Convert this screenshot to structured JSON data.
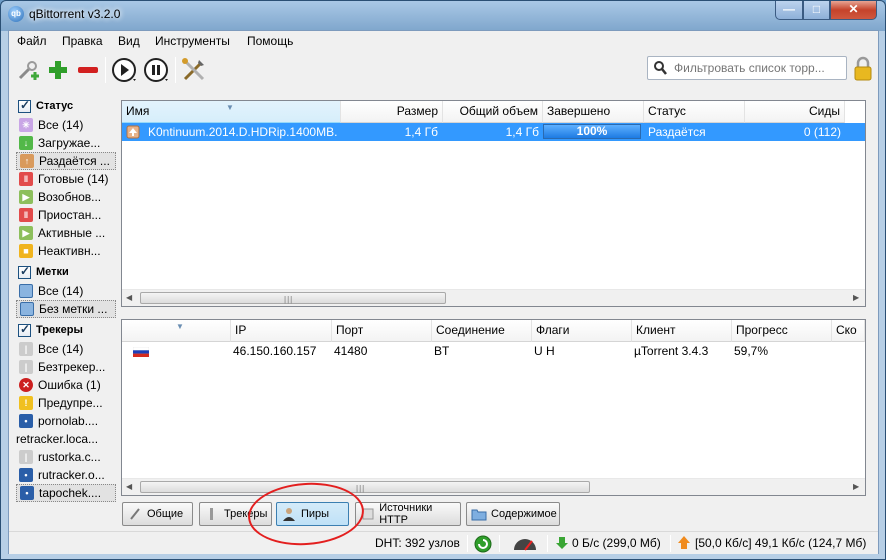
{
  "window": {
    "title": "qBittorrent v3.2.0",
    "minimize": "—",
    "maximize": "□",
    "close": "✕"
  },
  "menu": [
    "Файл",
    "Правка",
    "Вид",
    "Инструменты",
    "Помощь"
  ],
  "search": {
    "placeholder": "Фильтровать список торр..."
  },
  "sidebar": {
    "status_header": "Статус",
    "status_items": [
      {
        "label": "Все (14)",
        "icon": "all-icon"
      },
      {
        "label": "Загружае...",
        "icon": "download-icon"
      },
      {
        "label": "Раздаётся ...",
        "icon": "upload-icon"
      },
      {
        "label": "Готовые (14)",
        "icon": "completed-icon"
      },
      {
        "label": "Возобнов...",
        "icon": "resume-icon"
      },
      {
        "label": "Приостан...",
        "icon": "paused-icon"
      },
      {
        "label": "Активные ...",
        "icon": "active-icon"
      },
      {
        "label": "Неактивн...",
        "icon": "inactive-icon"
      }
    ],
    "labels_header": "Метки",
    "label_items": [
      {
        "label": "Все (14)",
        "icon": "folder-icon"
      },
      {
        "label": "Без метки ...",
        "icon": "folder-icon"
      }
    ],
    "trackers_header": "Трекеры",
    "tracker_items": [
      {
        "label": "Все (14)",
        "icon": "tracker-icon"
      },
      {
        "label": "Безтрекер...",
        "icon": "tracker-icon"
      },
      {
        "label": "Ошибка (1)",
        "icon": "error-icon"
      },
      {
        "label": "Предупре...",
        "icon": "warning-icon"
      },
      {
        "label": "pornolab....",
        "icon": "favicon-icon"
      },
      {
        "label": "retracker.loca...",
        "icon": ""
      },
      {
        "label": "rustorka.c...",
        "icon": "tracker-icon"
      },
      {
        "label": "rutracker.o...",
        "icon": "favicon-icon"
      },
      {
        "label": "tapochek....",
        "icon": "favicon-icon"
      }
    ]
  },
  "torrents": {
    "columns": [
      "Имя",
      "Размер",
      "Общий объем",
      "Завершено",
      "Статус",
      "Сиды"
    ],
    "rows": [
      {
        "name": "K0ntinuum.2014.D.HDRip.1400MB...",
        "size": "1,4 Гб",
        "total": "1,4 Гб",
        "progress": "100%",
        "progress_fraction": 1.0,
        "status": "Раздаётся",
        "seeds": "0 (112)"
      }
    ]
  },
  "peers": {
    "columns": [
      "",
      "IP",
      "Порт",
      "Соединение",
      "Флаги",
      "Клиент",
      "Прогресс",
      "Ско"
    ],
    "rows": [
      {
        "flag": "ru-flag-icon",
        "ip": "46.150.160.157",
        "port": "41480",
        "connection": "BT",
        "flags": "U H",
        "client": "µTorrent 3.4.3",
        "progress": "59,7%"
      }
    ]
  },
  "tabs": [
    "Общие",
    "Трекеры",
    "Пиры",
    "Источники HTTP",
    "Содержимое"
  ],
  "statusbar": {
    "dht": "DHT: 392 узлов",
    "download": "0 Б/с (299,0 Мб)",
    "upload": "[50,0 Кб/с] 49,1 Кб/с (124,7 Мб)"
  },
  "colors": {
    "selection": "#3399ff",
    "annotation": "#e31f1f"
  }
}
